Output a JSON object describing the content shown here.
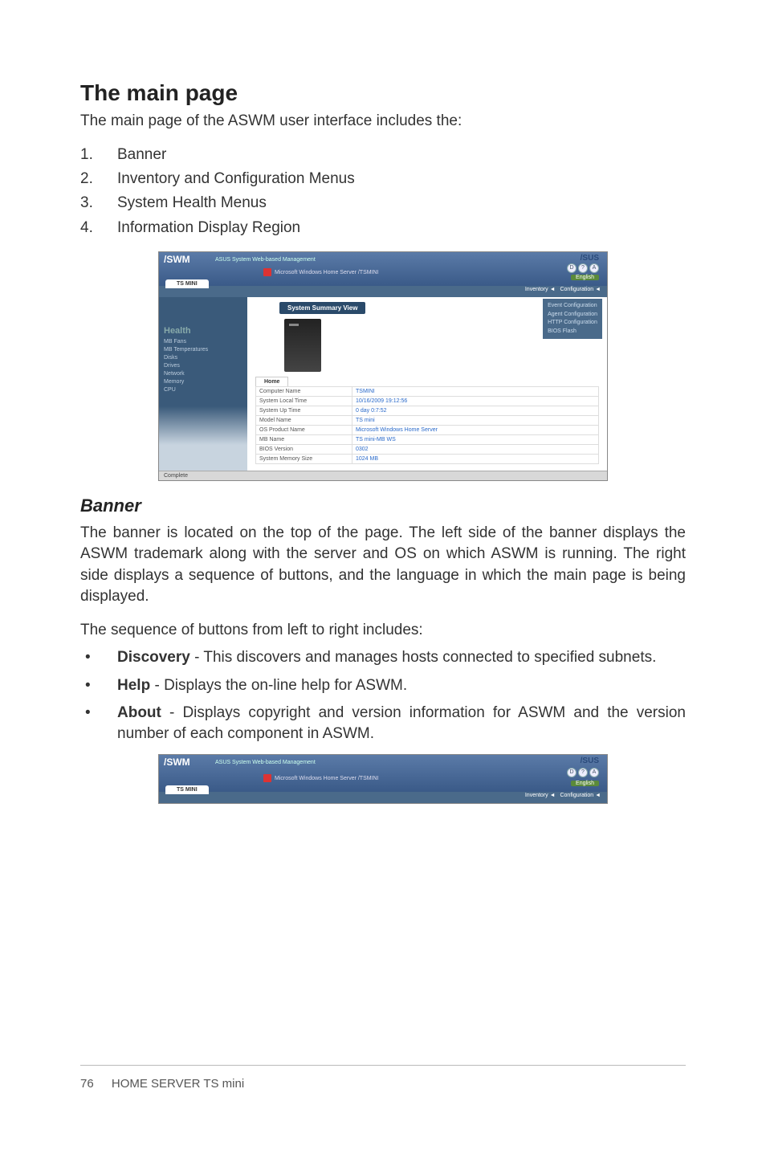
{
  "heading": "The main page",
  "intro": "The main page of the ASWM user interface includes the:",
  "list_items": [
    {
      "num": "1.",
      "text": "Banner"
    },
    {
      "num": "2.",
      "text": "Inventory and Configuration Menus"
    },
    {
      "num": "3.",
      "text": "System Health Menus"
    },
    {
      "num": "4.",
      "text": "Information Display Region"
    }
  ],
  "screenshot_main": {
    "logo": "/SWM",
    "logo_sub": "ASUS System Web-based Management",
    "os_line": "Microsoft Windows Home Server /TSMINI",
    "asus": "/SUS",
    "btn_d": "D",
    "btn_h": "?",
    "btn_a": "A",
    "lang": "English",
    "tab": "TS MINI",
    "menu_inventory": "Inventory ◄",
    "menu_config": "Configuration ◄",
    "summary_btn": "System Summary View",
    "config_items": [
      "Event Configuration",
      "Agent Configuration",
      "HTTP Configuration",
      "BIOS Flash"
    ],
    "sidebar_header": "Health",
    "sidebar_items": [
      "MB Fans",
      "MB Temperatures",
      "Disks",
      "Drives",
      "Network",
      "Memory",
      "CPU"
    ],
    "home_tab": "Home",
    "info_rows": [
      {
        "k": "Computer Name",
        "v": "TSMINI"
      },
      {
        "k": "System Local Time",
        "v": "10/16/2009 19:12:56"
      },
      {
        "k": "System Up Time",
        "v": "0 day 0:7:52"
      },
      {
        "k": "Model Name",
        "v": "TS mini"
      },
      {
        "k": "OS Product Name",
        "v": "Microsoft Windows Home Server"
      },
      {
        "k": "MB Name",
        "v": "TS mini-MB WS"
      },
      {
        "k": "BIOS Version",
        "v": "0302"
      },
      {
        "k": "System Memory Size",
        "v": "1024 MB"
      }
    ],
    "status": "Complete"
  },
  "banner_heading": "Banner",
  "banner_para": "The banner is located on the top of the page. The left side of the banner displays the ASWM trademark along with the server and OS on which ASWM is running. The right side displays a sequence of buttons, and the language in which the main page is being displayed.",
  "seq_intro": "The sequence of buttons from left to right includes:",
  "bullets": [
    {
      "bold": "Discovery",
      "rest": " - This discovers and manages hosts connected to specified subnets."
    },
    {
      "bold": "Help",
      "rest": " - Displays the on-line help for ASWM."
    },
    {
      "bold": "About",
      "rest": " - Displays copyright and version information for ASWM and the version number of each component in ASWM."
    }
  ],
  "screenshot_banner": {
    "logo": "/SWM",
    "logo_sub": "ASUS System Web-based Management",
    "os_line": "Microsoft Windows Home Server /TSMINI",
    "asus": "/SUS",
    "lang": "English",
    "tab": "TS MINI",
    "menu_inventory": "Inventory ◄",
    "menu_config": "Configuration ◄"
  },
  "footer": {
    "page": "76",
    "title": "HOME SERVER TS mini"
  }
}
